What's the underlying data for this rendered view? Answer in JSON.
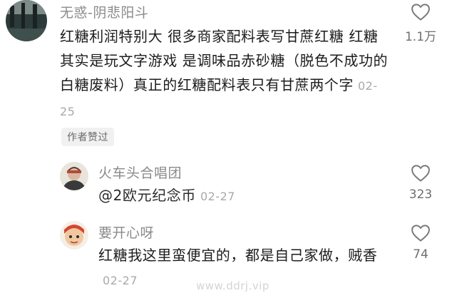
{
  "comments": [
    {
      "username": "无惑-阴悲阳斗",
      "text": "红糖利润特别大 很多商家配料表写甘蔗红糖 红糖 其实是玩文字游戏 是调味品赤砂糖（脱色不成功的白糖废料）真正的红糖配料表只有甘蔗两个字",
      "date": "02-25",
      "likes": "1.1万",
      "badge": "作者赞过"
    },
    {
      "username": "火车头合唱团",
      "mention": "@2欧元纪念币",
      "date": "02-27",
      "likes": "323"
    },
    {
      "username": "要开心呀",
      "text": "红糖我这里蛮便宜的，都是自己家做，贼香",
      "date": "02-27",
      "likes": "74"
    }
  ],
  "watermark": "www.ddrj.vip",
  "icons": {
    "like": "heart-outline-icon"
  }
}
